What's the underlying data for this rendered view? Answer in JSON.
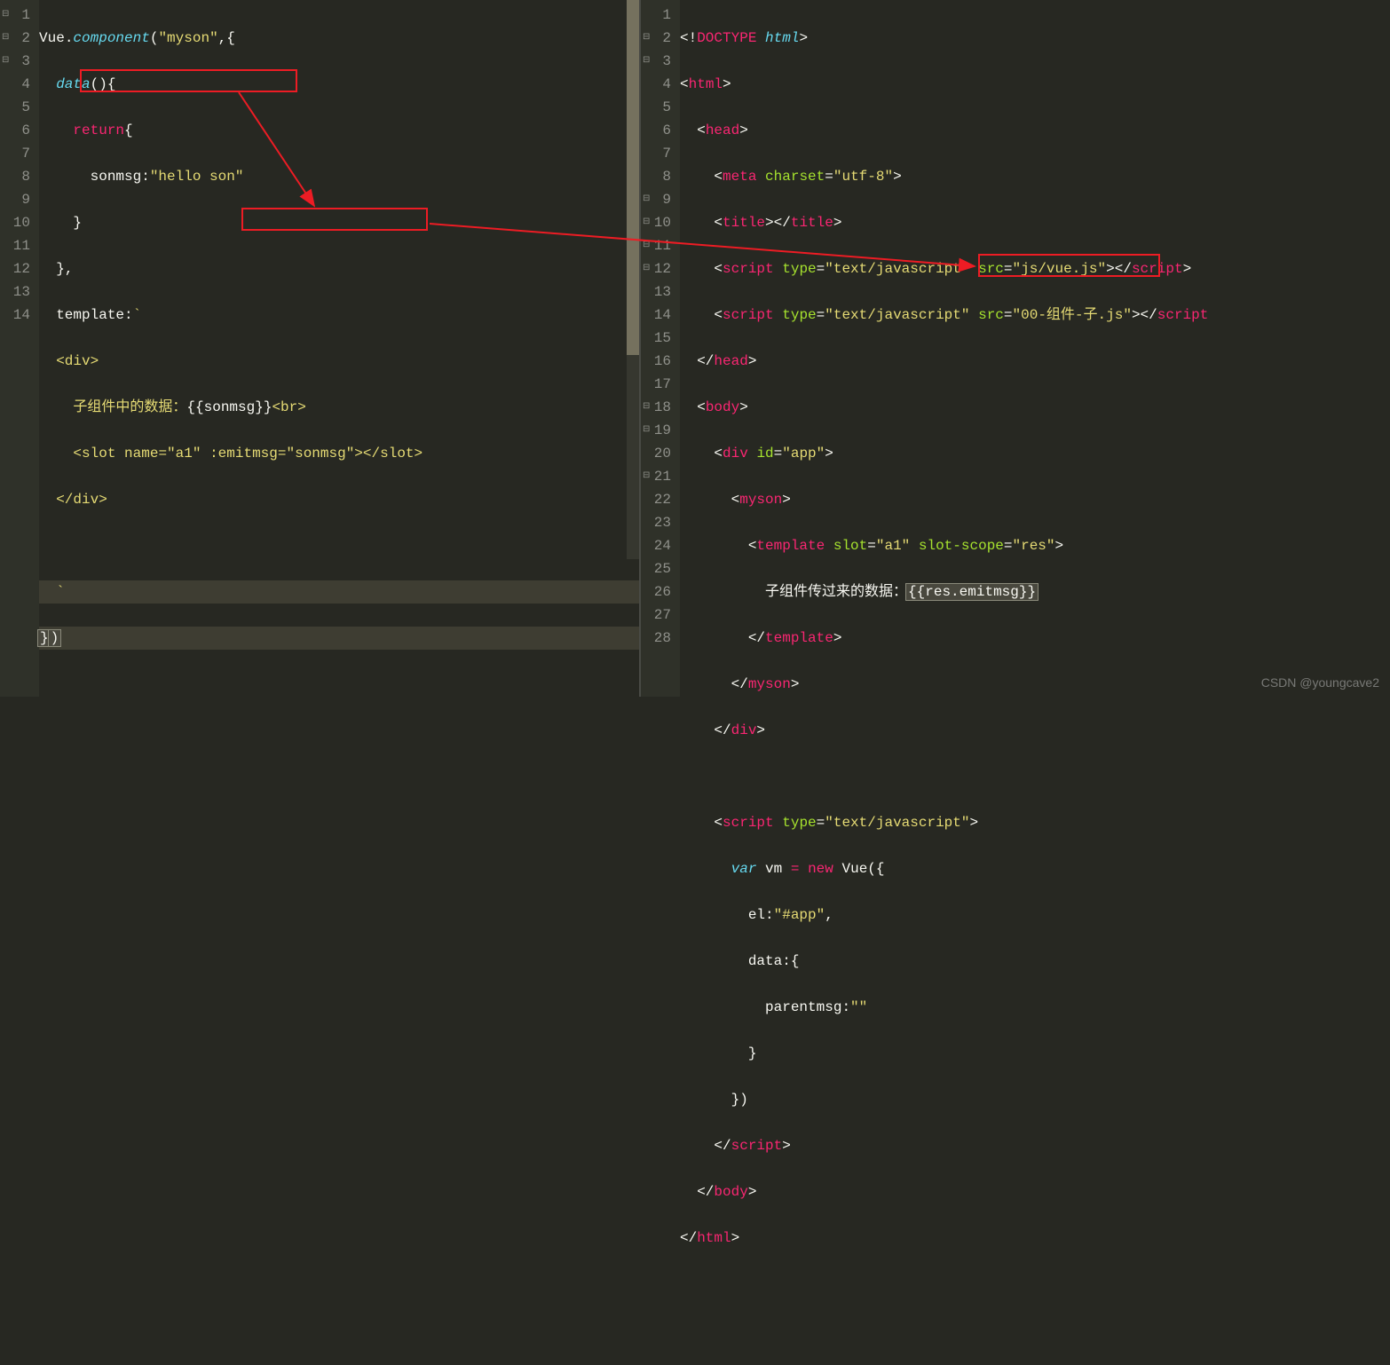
{
  "left": {
    "lines": [
      "1",
      "2",
      "3",
      "4",
      "5",
      "6",
      "7",
      "8",
      "9",
      "10",
      "11",
      "12",
      "13",
      "14"
    ],
    "t": {
      "vue": "Vue",
      "dot": ".",
      "component": "component",
      "lp": "(",
      "rp": ")",
      "myson": "\"myson\"",
      "comma": ",",
      "lb": "{",
      "rb": "}",
      "data": "data",
      "return": "return",
      "sonmsg": "sonmsg",
      "colon": ":",
      "hello": "\"hello son\"",
      "template": "template",
      "backtick": "`",
      "div_o": "<div>",
      "div_c": "</div>",
      "child_text": "子组件中的数据：",
      "mustache_o": "{{",
      "mustache_c": "}}",
      "br": "<br>",
      "lt": "<",
      "gt": ">",
      "slot": "slot",
      "name_attr": "name",
      "a1": "\"a1\"",
      "emitmsg_attr": ":emitmsg",
      "sonmsg_str": "\"sonmsg\"",
      "slot_c": "</slot>",
      "close": "})"
    }
  },
  "right": {
    "lines": [
      "1",
      "2",
      "3",
      "4",
      "5",
      "6",
      "7",
      "8",
      "9",
      "10",
      "11",
      "12",
      "13",
      "14",
      "15",
      "16",
      "17",
      "18",
      "19",
      "20",
      "21",
      "22",
      "23",
      "24",
      "25",
      "26",
      "27",
      "28"
    ],
    "t": {
      "doctype": "<!",
      "DOCTYPE": "DOCTYPE",
      "html_w": "html",
      "gt": ">",
      "lt": "<",
      "ltc": "</",
      "head": "head",
      "meta": "meta",
      "charset": "charset",
      "utf8": "\"utf-8\"",
      "title": "title",
      "script": "script",
      "type": "type",
      "js": "\"text/javascript\"",
      "src": "src",
      "vuejs": "\"js/vue.js\"",
      "childjs": "\"00-组件-子.js\"",
      "body": "body",
      "div": "div",
      "id": "id",
      "app": "\"app\"",
      "myson": "myson",
      "template": "template",
      "slot_attr": "slot",
      "a1": "\"a1\"",
      "slotscope": "slot-scope",
      "res_str": "\"res\"",
      "child_data": "子组件传过来的数据：",
      "mustache_o": "{{",
      "mustache_c": "}}",
      "res": "res",
      "dot": ".",
      "emitmsg": "emitmsg",
      "var": "var",
      "vm": "vm",
      "eq": "=",
      "new": "new",
      "Vue": "Vue",
      "lp": "(",
      "rp": ")",
      "lb": "{",
      "rb": "}",
      "el": "el",
      "colon": ":",
      "appsel": "\"#app\"",
      "comma": ",",
      "data": "data",
      "parentmsg": "parentmsg",
      "empty": "\"\""
    }
  },
  "watermark": "CSDN @youngcave2"
}
